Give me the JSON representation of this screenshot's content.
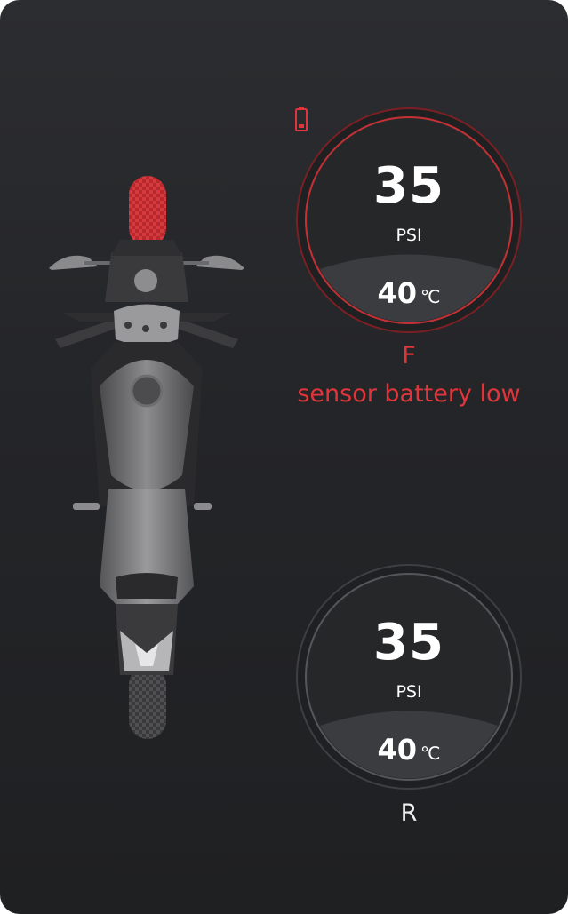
{
  "front": {
    "pressure": "35",
    "pressure_unit": "PSI",
    "temperature": "40",
    "temperature_unit": "℃",
    "label": "F",
    "warning": "sensor battery low",
    "status_color": "#e0353a",
    "battery_icon": "battery-low-icon"
  },
  "rear": {
    "pressure": "35",
    "pressure_unit": "PSI",
    "temperature": "40",
    "temperature_unit": "℃",
    "label": "R",
    "status_color": "#4a4b4e"
  },
  "colors": {
    "background": "#262729",
    "alert": "#e0353a",
    "text": "#ffffff"
  }
}
